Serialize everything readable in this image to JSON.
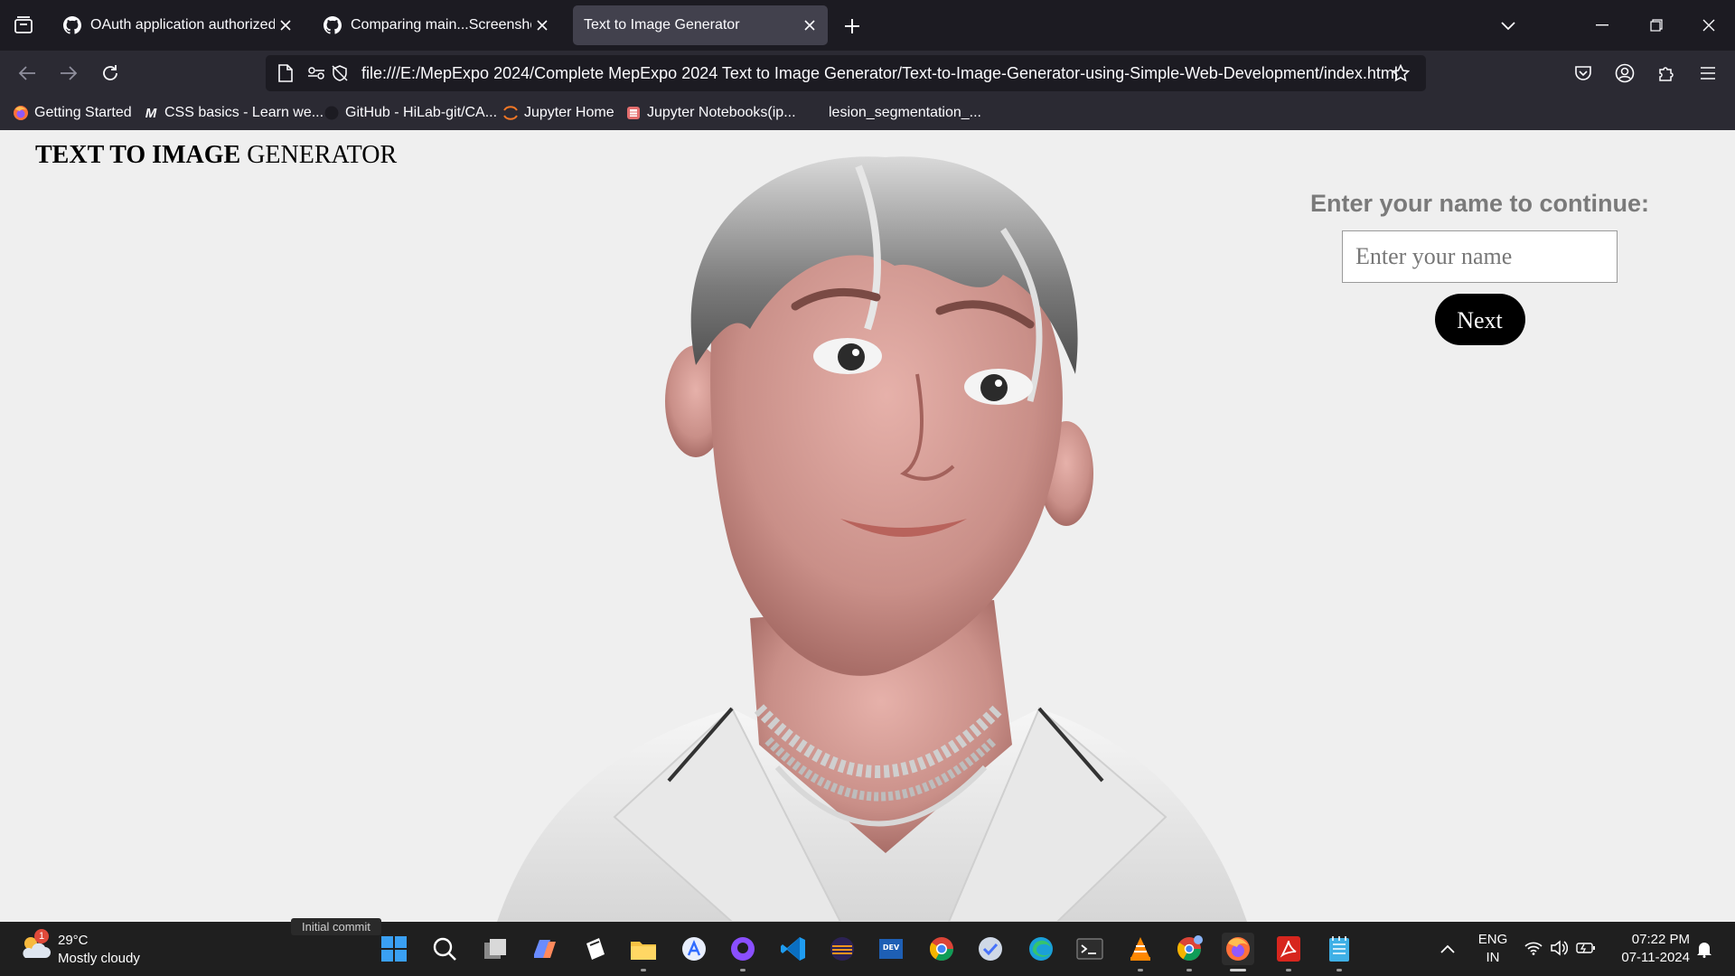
{
  "browser": {
    "tabs": [
      {
        "title": "OAuth application authorized",
        "favicon": "github-icon",
        "active": false
      },
      {
        "title": "Comparing main...Screenshot-o",
        "favicon": "github-icon",
        "active": false
      },
      {
        "title": "Text to Image Generator",
        "favicon": "none",
        "active": true
      }
    ],
    "url": "file:///E:/MepExpo 2024/Complete MepExpo 2024 Text to Image Generator/Text-to-Image-Generator-using-Simple-Web-Development/index.html",
    "bookmarks": [
      {
        "label": "Getting Started",
        "icon": "firefox-icon"
      },
      {
        "label": "CSS basics - Learn we...",
        "icon": "mdn-icon"
      },
      {
        "label": "GitHub - HiLab-git/CA...",
        "icon": "github-icon"
      },
      {
        "label": "Jupyter Home",
        "icon": "jupyter-icon"
      },
      {
        "label": "Jupyter Notebooks(ip...",
        "icon": "notebook-icon"
      },
      {
        "label": "lesion_segmentation_...",
        "icon": "blank-icon"
      }
    ],
    "accent": "#42414d"
  },
  "page": {
    "title_bold": "TEXT TO IMAGE",
    "title_rest": " GENERATOR",
    "prompt": "Enter your name to continue:",
    "name_placeholder": "Enter your name",
    "next_label": "Next"
  },
  "taskbar": {
    "weather": {
      "temp": "29°C",
      "condition": "Mostly cloudy",
      "badge": "1"
    },
    "tooltip": "Initial commit",
    "apps": [
      "windows-start-icon",
      "search-icon",
      "task-view-icon",
      "copilot-icon",
      "notion-icon",
      "file-explorer-icon",
      "app-store-icon",
      "github-desktop-icon",
      "vscode-icon",
      "eclipse-icon",
      "devc-icon",
      "chrome-icon",
      "ticktick-icon",
      "edge-icon",
      "terminal-icon",
      "vlc-icon",
      "chrome-profile-icon",
      "firefox-icon",
      "acrobat-icon",
      "notepad-icon"
    ],
    "language": {
      "line1": "ENG",
      "line2": "IN"
    },
    "time": "07:22 PM",
    "date": "07-11-2024"
  }
}
